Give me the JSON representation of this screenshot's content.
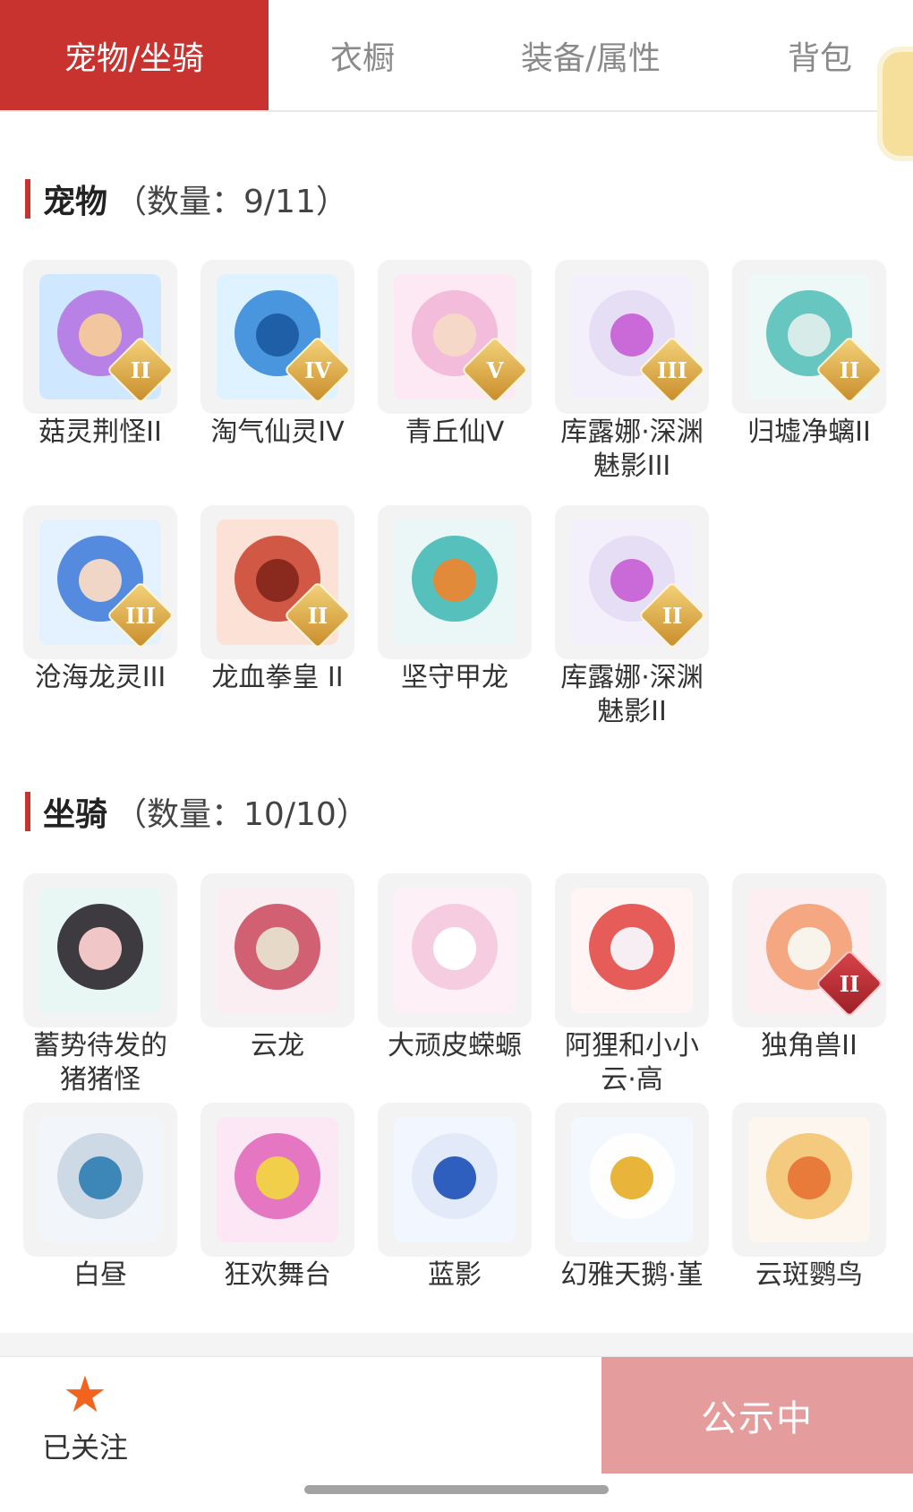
{
  "tabs": [
    {
      "label": "宠物/坐骑",
      "active": true
    },
    {
      "label": "衣橱",
      "active": false
    },
    {
      "label": "装备/属性",
      "active": false
    },
    {
      "label": "背包",
      "active": false
    }
  ],
  "pets_section": {
    "title": "宠物",
    "count": "（数量：9/11）",
    "items": [
      {
        "name": "菇灵荆怪II",
        "badge": "II",
        "colors": [
          "#cfe7ff",
          "#b46fe0",
          "#f2c7a0"
        ]
      },
      {
        "name": "淘气仙灵IV",
        "badge": "IV",
        "colors": [
          "#dff2ff",
          "#2f86d8",
          "#1f5fa8"
        ]
      },
      {
        "name": "青丘仙V",
        "badge": "V",
        "colors": [
          "#fde9f3",
          "#f2b4d6",
          "#f6d8c8"
        ]
      },
      {
        "name": "库露娜·深渊魅影III",
        "badge": "III",
        "colors": [
          "#f4f0fb",
          "#e3dbf3",
          "#c96ad8"
        ]
      },
      {
        "name": "归墟净螭II",
        "badge": "II",
        "colors": [
          "#eef8f6",
          "#4fbdb6",
          "#d7ece8"
        ]
      },
      {
        "name": "沧海龙灵III",
        "badge": "III",
        "colors": [
          "#e4f2ff",
          "#3c79d9",
          "#f0d6c6"
        ]
      },
      {
        "name": "龙血拳皇 II",
        "badge": "II",
        "colors": [
          "#fbe1d6",
          "#c8402c",
          "#8a2a1e"
        ]
      },
      {
        "name": "坚守甲龙",
        "badge": "",
        "colors": [
          "#eaf7f6",
          "#3cb6b2",
          "#e08a3a"
        ]
      },
      {
        "name": "库露娜·深渊魅影II",
        "badge": "II",
        "colors": [
          "#f4f0fb",
          "#e3dbf3",
          "#c96ad8"
        ]
      }
    ]
  },
  "mounts_section": {
    "title": "坐骑",
    "count": "（数量：10/10）",
    "items": [
      {
        "name": "蓄势待发的猪猪怪",
        "badge": "",
        "colors": [
          "#e8f7f4",
          "#1e1a1e",
          "#f0c6c6"
        ]
      },
      {
        "name": "云龙",
        "badge": "",
        "colors": [
          "#fbeef2",
          "#c8465c",
          "#e6d9c8"
        ]
      },
      {
        "name": "大顽皮蝾螈",
        "badge": "",
        "colors": [
          "#fdf1f7",
          "#f4c5dc",
          "#ffffff"
        ]
      },
      {
        "name": "阿狸和小小云·高",
        "badge": "",
        "colors": [
          "#fff5f5",
          "#e2413d",
          "#f7eef4"
        ]
      },
      {
        "name": "独角兽II",
        "badge": "II",
        "colors": [
          "#fdeef1",
          "#f29a6c",
          "#f8f4ec"
        ]
      },
      {
        "name": "白昼",
        "badge": "",
        "colors": [
          "#f2f6fb",
          "#c8d4e2",
          "#3d86b8"
        ]
      },
      {
        "name": "狂欢舞台",
        "badge": "",
        "colors": [
          "#fbe8f4",
          "#e061b8",
          "#f2cf4a"
        ]
      },
      {
        "name": "蓝影",
        "badge": "",
        "colors": [
          "#f2f6ff",
          "#dfe8f8",
          "#2e5fbf"
        ]
      },
      {
        "name": "幻雅天鹅·堇",
        "badge": "",
        "colors": [
          "#f3f8ff",
          "#ffffff",
          "#e8b43a"
        ]
      },
      {
        "name": "云斑鹦鸟",
        "badge": "",
        "colors": [
          "#fdf6ee",
          "#f2c26a",
          "#e87a3a"
        ]
      }
    ]
  },
  "bottom_bar": {
    "follow_icon": "star-icon",
    "follow_label": "已关注",
    "status_label": "公示中",
    "accent_color": "#c8322f",
    "status_color": "#e59c9c"
  }
}
